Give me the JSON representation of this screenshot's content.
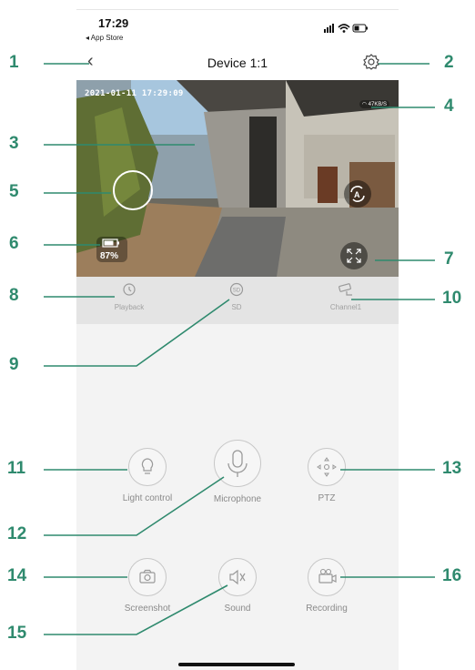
{
  "status_bar": {
    "time": "17:29",
    "back_to_app": "◂ App Store"
  },
  "header": {
    "title": "Device 1:1"
  },
  "video": {
    "timestamp": "2021-01-11 17:29:09",
    "net_speed": "47KB/S",
    "battery_percent": "87%"
  },
  "toolbar": {
    "playback_label": "Playback",
    "sd_label": "SD",
    "channel_label": "Channel1"
  },
  "controls": {
    "light_label": "Light control",
    "microphone_label": "Microphone",
    "ptz_label": "PTZ",
    "screenshot_label": "Screenshot",
    "sound_label": "Sound",
    "recording_label": "Recording"
  },
  "annotations": {
    "n1": "1",
    "n2": "2",
    "n3": "3",
    "n4": "4",
    "n5": "5",
    "n6": "6",
    "n7": "7",
    "n8": "8",
    "n9": "9",
    "n10": "10",
    "n11": "11",
    "n12": "12",
    "n13": "13",
    "n14": "14",
    "n15": "15",
    "n16": "16"
  },
  "colors": {
    "annotation": "#2f8a6e",
    "background": "#f3f3f3",
    "toolbar": "#e4e4e4"
  }
}
